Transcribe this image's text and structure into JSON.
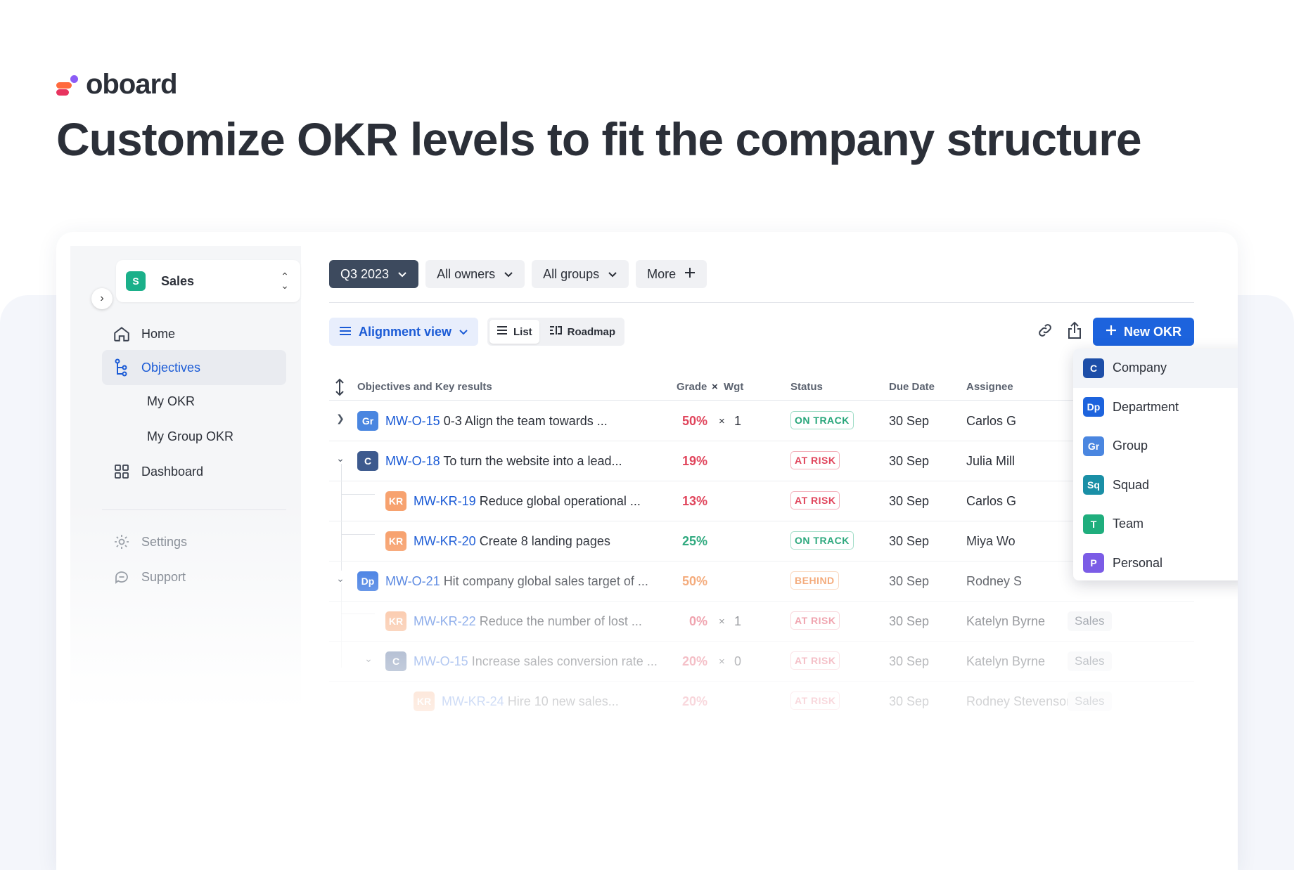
{
  "brand": {
    "name": "oboard"
  },
  "headline": "Customize OKR levels to fit the company structure",
  "colors": {
    "company": "#1d4ea8",
    "department": "#1d63dd",
    "group": "#4a86e0",
    "squad": "#1a8fa6",
    "team": "#1fae7d",
    "personal": "#7b5ce6",
    "kr": "#f7a26f",
    "primary": "#1d63dd"
  },
  "sidebar": {
    "workspace": {
      "badge": "S",
      "name": "Sales"
    },
    "items": [
      {
        "label": "Home",
        "icon": "home-icon"
      },
      {
        "label": "Objectives",
        "icon": "alignment-tree-icon"
      },
      {
        "label": "My OKR"
      },
      {
        "label": "My Group OKR"
      },
      {
        "label": "Dashboard",
        "icon": "dashboard-grid-icon"
      },
      {
        "label": "Settings",
        "icon": "gear-icon"
      },
      {
        "label": "Support",
        "icon": "chat-bubble-icon"
      }
    ]
  },
  "filters": {
    "period": "Q3 2023",
    "owners": "All owners",
    "groups": "All groups",
    "more": "More"
  },
  "view": {
    "mode": "Alignment view",
    "list": "List",
    "roadmap": "Roadmap",
    "new_okr": "New OKR"
  },
  "table": {
    "headers": {
      "title": "Objectives and Key results",
      "grade": "Grade",
      "wgt": "Wgt",
      "status": "Status",
      "due": "Due Date",
      "assignee": "Assignee"
    },
    "rows": [
      {
        "level": "Gr",
        "id": "MW-O-15",
        "title": "0-3  Align the team towards ...",
        "grade": "50%",
        "wgt": "1",
        "status": "ON TRACK",
        "due": "30 Sep",
        "assignee": "Carlos G",
        "group": ""
      },
      {
        "level": "C",
        "id": "MW-O-18",
        "title": "To turn the website into a lead...",
        "grade": "19%",
        "wgt": "",
        "status": "AT RISK",
        "due": "30 Sep",
        "assignee": "Julia Mill",
        "group": ""
      },
      {
        "level": "KR",
        "id": "MW-KR-19",
        "title": "Reduce global operational ...",
        "grade": "13%",
        "wgt": "",
        "status": "AT RISK",
        "due": "30 Sep",
        "assignee": "Carlos G",
        "group": ""
      },
      {
        "level": "KR",
        "id": "MW-KR-20",
        "title": "Create 8 landing pages",
        "grade": "25%",
        "wgt": "",
        "status": "ON TRACK",
        "due": "30 Sep",
        "assignee": "Miya Wo",
        "group": ""
      },
      {
        "level": "Dp",
        "id": "MW-O-21",
        "title": "Hit company global sales target of ...",
        "grade": "50%",
        "wgt": "",
        "status": "BEHIND",
        "due": "30 Sep",
        "assignee": "Rodney S",
        "group": ""
      },
      {
        "level": "KR",
        "id": "MW-KR-22",
        "title": "Reduce the number of lost ...",
        "grade": "0%",
        "wgt": "1",
        "status": "AT RISK",
        "due": "30 Sep",
        "assignee": "Katelyn Byrne",
        "group": "Sales"
      },
      {
        "level": "C",
        "id": "MW-O-15",
        "title": "Increase sales conversion rate ...",
        "grade": "20%",
        "wgt": "0",
        "status": "AT RISK",
        "due": "30 Sep",
        "assignee": "Katelyn Byrne",
        "group": "Sales"
      },
      {
        "level": "KR",
        "id": "MW-KR-24",
        "title": "Hire 10 new sales...",
        "grade": "20%",
        "wgt": "",
        "status": "AT RISK",
        "due": "30 Sep",
        "assignee": "Rodney Stevenson",
        "group": "Sales"
      }
    ]
  },
  "level_menu": {
    "items": [
      {
        "badge": "C",
        "label": "Company"
      },
      {
        "badge": "Dp",
        "label": "Department"
      },
      {
        "badge": "Gr",
        "label": "Group"
      },
      {
        "badge": "Sq",
        "label": "Squad"
      },
      {
        "badge": "T",
        "label": "Team"
      },
      {
        "badge": "P",
        "label": "Personal"
      }
    ]
  }
}
